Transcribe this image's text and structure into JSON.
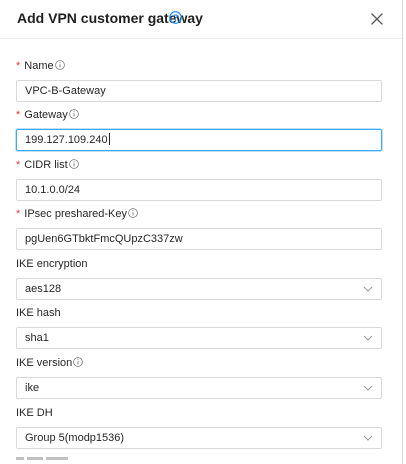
{
  "dialog": {
    "title": "Add VPN customer gateway"
  },
  "form": {
    "name": {
      "label": "Name",
      "value": "VPC-B-Gateway"
    },
    "gateway": {
      "label": "Gateway",
      "value": "199.127.109.240"
    },
    "cidr": {
      "label": "CIDR list",
      "value": "10.1.0.0/24"
    },
    "ipsec": {
      "label": "IPsec preshared-Key",
      "value": "pgUen6GTbktFmcQUpzC337zw"
    },
    "ike_encryption": {
      "label": "IKE encryption",
      "value": "aes128"
    },
    "ike_hash": {
      "label": "IKE hash",
      "value": "sha1"
    },
    "ike_version": {
      "label": "IKE version",
      "value": "ike"
    },
    "ike_dh": {
      "label": "IKE DH",
      "value": "Group 5(modp1536)"
    }
  },
  "required_marker": "*",
  "colors": {
    "accent": "#1890ff",
    "required": "#e53935",
    "border": "#d9d9d9"
  }
}
